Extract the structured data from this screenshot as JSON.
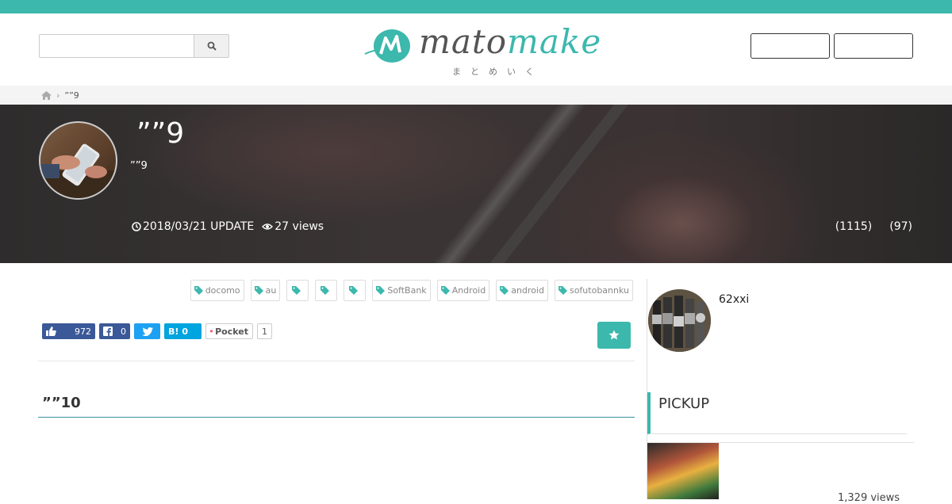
{
  "header": {
    "search": {
      "placeholder": "",
      "value": ""
    },
    "logo": {
      "text_main": "mato",
      "text_accent": "make",
      "subtitle": "まとめいく"
    },
    "buttons": [
      "",
      ""
    ]
  },
  "breadcrumb": {
    "current": "””9"
  },
  "hero": {
    "title": "””9",
    "subtitle": "””9",
    "updated": "2018/03/21 UPDATE",
    "views": "27 views",
    "count_a": "(1115)",
    "count_b": "(97)"
  },
  "tags": [
    "docomo",
    "au",
    "",
    "",
    "",
    "SoftBank",
    "Android",
    "android",
    "sofutobannku"
  ],
  "share": {
    "facebook_like_count": "972",
    "facebook_share_count": "0",
    "hatena_count": "0",
    "hatena_label": "B!",
    "pocket_label": "Pocket",
    "pocket_count": "1"
  },
  "section": {
    "heading": "””10"
  },
  "sidebar": {
    "author_name": "62xxi",
    "pickup_title": "PICKUP",
    "pickup_item_views": "1,329 views"
  },
  "colors": {
    "accent": "#3cb8ad",
    "facebook": "#3b5998",
    "twitter": "#1da1f2",
    "hatena": "#00a4de"
  },
  "icons": {
    "search": "search-icon",
    "home": "home-icon",
    "clock": "clock-icon",
    "eye": "eye-icon",
    "tag": "tag-icon",
    "thumbs_up": "thumbs-up-icon",
    "facebook": "facebook-icon",
    "twitter": "twitter-icon",
    "pocket": "pocket-icon",
    "star": "star-icon"
  }
}
